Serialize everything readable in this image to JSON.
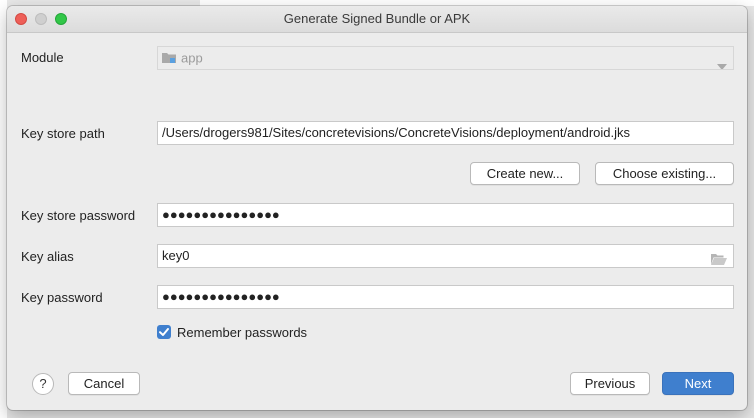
{
  "window": {
    "title": "Generate Signed Bundle or APK"
  },
  "form": {
    "module_label": "Module",
    "module_value": "app",
    "keystore_path_label": "Key store path",
    "keystore_path_value": "/Users/drogers981/Sites/concretevisions/ConcreteVisions/deployment/android.jks",
    "create_new_label": "Create new...",
    "choose_existing_label": "Choose existing...",
    "keystore_password_label": "Key store password",
    "keystore_password_masked": "●●●●●●●●●●●●●●●",
    "key_alias_label": "Key alias",
    "key_alias_value": "key0",
    "key_password_label": "Key password",
    "key_password_masked": "●●●●●●●●●●●●●●●",
    "remember_label": "Remember passwords",
    "remember_checked": true
  },
  "footer": {
    "help_label": "?",
    "cancel_label": "Cancel",
    "previous_label": "Previous",
    "next_label": "Next"
  },
  "colors": {
    "accent": "#3f7fce",
    "close": "#ee5f58",
    "zoom": "#32c748"
  }
}
